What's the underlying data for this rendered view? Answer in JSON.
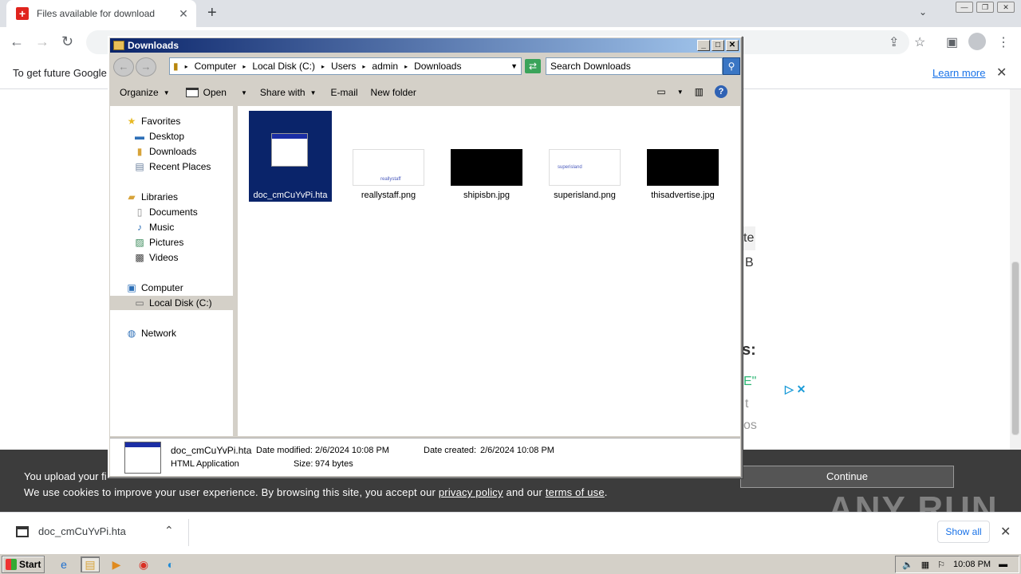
{
  "browser": {
    "tab_title": "Files available for download",
    "new_tab": "+",
    "infobar_message": "To get future Google",
    "learn_more": "Learn more",
    "close": "✕"
  },
  "page": {
    "fragments": [
      "te",
      "B",
      "s:",
      "E\"",
      "t",
      "os"
    ],
    "cookie_line1": "You upload your fi",
    "cookie_line2_prefix": "We use cookies to improve your user experience. By browsing this site, you accept our",
    "privacy_link": "privacy policy",
    "and_text": "and our",
    "terms_link": "terms of use",
    "period": ".",
    "continue": "Continue",
    "watermark": "ANY RUN"
  },
  "download_bar": {
    "filename": "doc_cmCuYvPi.hta",
    "show_all": "Show all"
  },
  "taskbar": {
    "start": "Start",
    "time": "10:08 PM"
  },
  "explorer": {
    "title": "Downloads",
    "breadcrumb": [
      "Computer",
      "Local Disk (C:)",
      "Users",
      "admin",
      "Downloads"
    ],
    "search_placeholder": "Search Downloads",
    "commands": {
      "organize": "Organize",
      "open": "Open",
      "share_with": "Share with",
      "email": "E-mail",
      "new_folder": "New folder"
    },
    "nav": {
      "favorites": "Favorites",
      "desktop": "Desktop",
      "downloads": "Downloads",
      "recent": "Recent Places",
      "libraries": "Libraries",
      "documents": "Documents",
      "music": "Music",
      "pictures": "Pictures",
      "videos": "Videos",
      "computer": "Computer",
      "local_disk": "Local Disk (C:)",
      "network": "Network"
    },
    "files": [
      {
        "name": "doc_cmCuYvPi.hta",
        "thumb_text": ""
      },
      {
        "name": "reallystaff.png",
        "thumb_text": "reallystaff"
      },
      {
        "name": "shipisbn.jpg",
        "thumb_text": ""
      },
      {
        "name": "superisland.png",
        "thumb_text": "superisland"
      },
      {
        "name": "thisadvertise.jpg",
        "thumb_text": ""
      }
    ],
    "details": {
      "name": "doc_cmCuYvPi.hta",
      "type": "HTML Application",
      "modified_label": "Date modified:",
      "modified": "2/6/2024 10:08 PM",
      "created_label": "Date created:",
      "created": "2/6/2024 10:08 PM",
      "size_label": "Size:",
      "size": "974 bytes"
    }
  }
}
